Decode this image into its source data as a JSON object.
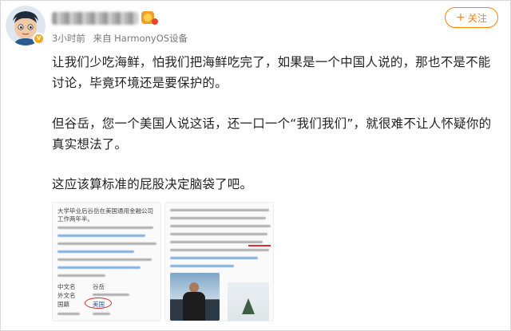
{
  "post": {
    "meta": {
      "time": "3小时前",
      "source": "来自 HarmonyOS设备"
    },
    "follow_label": "关注",
    "paragraphs": [
      "让我们少吃海鲜，怕我们把海鲜吃完了，如果是一个中国人说的，那也不是不能讨论，毕竟环境还是要保护的。",
      "但谷岳，您一个美国人说这话，还一口一个“我们我们”，就很难不让人怀疑你的真实想法了。",
      "这应该算标准的屁股决定脑袋了吧。"
    ]
  },
  "images": {
    "left": {
      "intro": "大学毕业后谷岳在美国通用金融公司工作两年半。",
      "rows": [
        {
          "label": "中文名",
          "value": "谷岳"
        },
        {
          "label": "外文名",
          "value": ""
        },
        {
          "label": "国籍",
          "value": "美国"
        }
      ]
    }
  },
  "colors": {
    "accent": "#ff8200",
    "verified": "#f5a623",
    "annotation_red": "#e02a2a"
  },
  "icons": {
    "verified": "verified-badge-icon",
    "plus": "plus-icon"
  }
}
